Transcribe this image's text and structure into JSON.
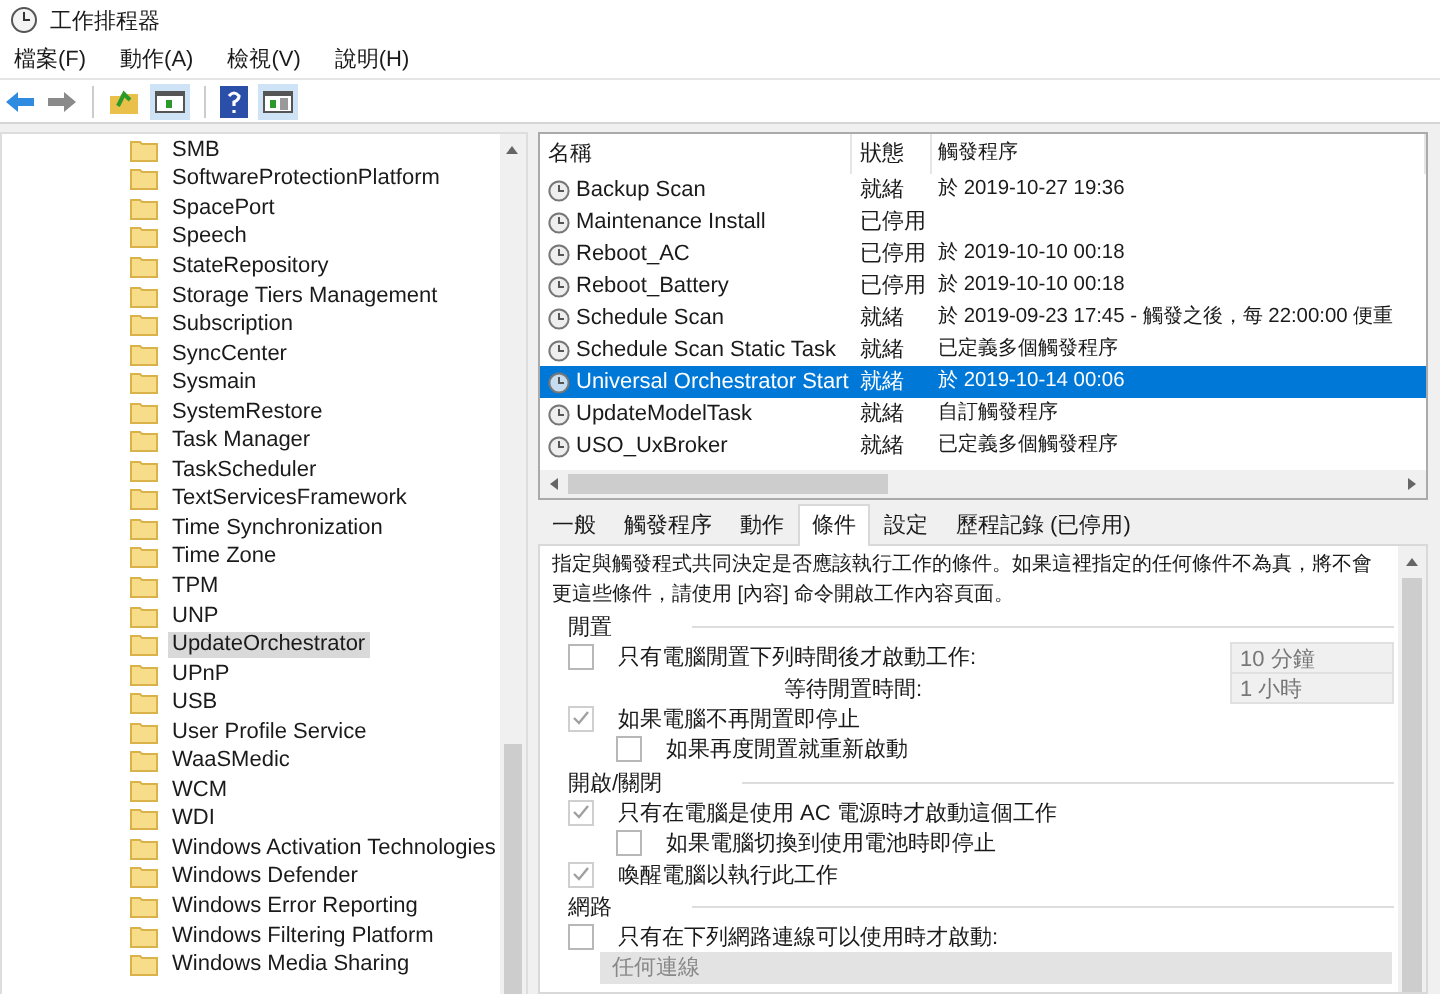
{
  "window": {
    "title": "工作排程器"
  },
  "menu": [
    "檔案(F)",
    "動作(A)",
    "檢視(V)",
    "說明(H)"
  ],
  "tree": {
    "items": [
      {
        "label": "SMB",
        "selected": false
      },
      {
        "label": "SoftwareProtectionPlatform",
        "selected": false
      },
      {
        "label": "SpacePort",
        "selected": false
      },
      {
        "label": "Speech",
        "selected": false
      },
      {
        "label": "StateRepository",
        "selected": false
      },
      {
        "label": "Storage Tiers Management",
        "selected": false
      },
      {
        "label": "Subscription",
        "selected": false
      },
      {
        "label": "SyncCenter",
        "selected": false
      },
      {
        "label": "Sysmain",
        "selected": false
      },
      {
        "label": "SystemRestore",
        "selected": false
      },
      {
        "label": "Task Manager",
        "selected": false
      },
      {
        "label": "TaskScheduler",
        "selected": false
      },
      {
        "label": "TextServicesFramework",
        "selected": false
      },
      {
        "label": "Time Synchronization",
        "selected": false
      },
      {
        "label": "Time Zone",
        "selected": false
      },
      {
        "label": "TPM",
        "selected": false
      },
      {
        "label": "UNP",
        "selected": false
      },
      {
        "label": "UpdateOrchestrator",
        "selected": true
      },
      {
        "label": "UPnP",
        "selected": false
      },
      {
        "label": "USB",
        "selected": false
      },
      {
        "label": "User Profile Service",
        "selected": false
      },
      {
        "label": "WaaSMedic",
        "selected": false
      },
      {
        "label": "WCM",
        "selected": false
      },
      {
        "label": "WDI",
        "selected": false
      },
      {
        "label": "Windows Activation Technologies",
        "selected": false
      },
      {
        "label": "Windows Defender",
        "selected": false
      },
      {
        "label": "Windows Error Reporting",
        "selected": false
      },
      {
        "label": "Windows Filtering Platform",
        "selected": false
      },
      {
        "label": "Windows Media Sharing",
        "selected": false
      }
    ]
  },
  "task_list": {
    "columns": [
      "名稱",
      "狀態",
      "觸發程序"
    ],
    "rows": [
      {
        "name": "Backup Scan",
        "status": "就緒",
        "trigger": "於 2019-10-27 19:36",
        "selected": false
      },
      {
        "name": "Maintenance Install",
        "status": "已停用",
        "trigger": "",
        "selected": false
      },
      {
        "name": "Reboot_AC",
        "status": "已停用",
        "trigger": "於 2019-10-10 00:18",
        "selected": false
      },
      {
        "name": "Reboot_Battery",
        "status": "已停用",
        "trigger": "於 2019-10-10 00:18",
        "selected": false
      },
      {
        "name": "Schedule Scan",
        "status": "就緒",
        "trigger": "於 2019-09-23 17:45 - 觸發之後，每 22:00:00 便重",
        "selected": false
      },
      {
        "name": "Schedule Scan Static Task",
        "status": "就緒",
        "trigger": "已定義多個觸發程序",
        "selected": false
      },
      {
        "name": "Universal Orchestrator Start",
        "status": "就緒",
        "trigger": "於 2019-10-14 00:06",
        "selected": true
      },
      {
        "name": "UpdateModelTask",
        "status": "就緒",
        "trigger": "自訂觸發程序",
        "selected": false
      },
      {
        "name": "USO_UxBroker",
        "status": "就緒",
        "trigger": "已定義多個觸發程序",
        "selected": false
      }
    ]
  },
  "tabs": [
    {
      "label": "一般",
      "selected": false
    },
    {
      "label": "觸發程序",
      "selected": false
    },
    {
      "label": "動作",
      "selected": false
    },
    {
      "label": "條件",
      "selected": true
    },
    {
      "label": "設定",
      "selected": false
    },
    {
      "label": "歷程記錄 (已停用)",
      "selected": false
    }
  ],
  "conditions": {
    "description": [
      "指定與觸發程式共同決定是否應該執行工作的條件。如果這裡指定的任何條件不為真，將不會",
      "更這些條件，請使用 [內容] 命令開啟工作內容頁面。"
    ],
    "sections": [
      {
        "title": "閒置",
        "items": [
          {
            "kind": "checkbox",
            "label": "只有電腦閒置下列時間後才啟動工作:",
            "checked": false,
            "dropdown": "10 分鐘"
          },
          {
            "kind": "label",
            "label": "等待閒置時間:",
            "dropdown": "1 小時"
          },
          {
            "kind": "checkbox",
            "label": "如果電腦不再閒置即停止",
            "checked": true,
            "children": [
              {
                "kind": "checkbox",
                "label": "如果再度閒置就重新啟動",
                "checked": false
              }
            ]
          }
        ]
      },
      {
        "title": "開啟/關閉",
        "items": [
          {
            "kind": "checkbox",
            "label": "只有在電腦是使用 AC 電源時才啟動這個工作",
            "checked": true,
            "children": [
              {
                "kind": "checkbox",
                "label": "如果電腦切換到使用電池時即停止",
                "checked": false
              }
            ]
          },
          {
            "kind": "checkbox",
            "label": "喚醒電腦以執行此工作",
            "checked": true
          }
        ]
      },
      {
        "title": "網路",
        "items": [
          {
            "kind": "checkbox",
            "label": "只有在下列網路連線可以使用時才啟動:",
            "checked": false
          },
          {
            "kind": "select",
            "label": "任何連線"
          }
        ]
      }
    ]
  }
}
